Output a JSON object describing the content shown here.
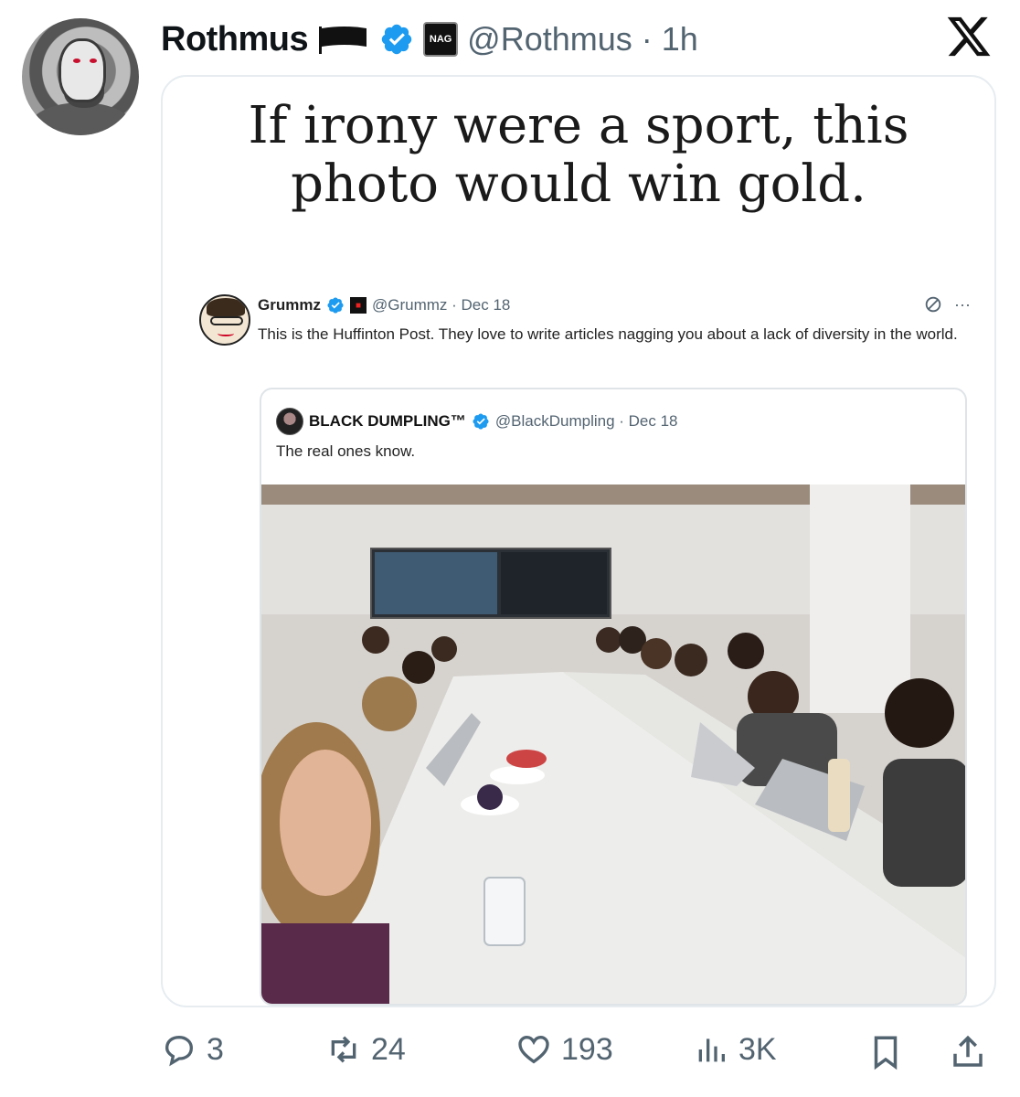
{
  "post": {
    "author_name": "Rothmus",
    "handle_time": "@Rothmus · 1h",
    "affiliate_badge": "NAG",
    "card_title": "If irony were a sport, this photo would win gold."
  },
  "quoted_tweet": {
    "name": "Grummz",
    "handle_date": "@Grummz · Dec 18",
    "text": "This is the Huffinton Post. They love to write articles nagging you about a lack of diversity in the world.",
    "more": "···"
  },
  "nested_quote": {
    "name": "BLACK DUMPLING™",
    "handle_date": "@BlackDumpling · Dec 18",
    "text": "The real ones know."
  },
  "actions": {
    "replies": "3",
    "reposts": "24",
    "likes": "193",
    "views": "3K"
  },
  "colors": {
    "verified": "#1d9bf0",
    "secondary_text": "#536471"
  },
  "icons": [
    "flag-icon",
    "verified-icon",
    "x-logo-icon",
    "reply-icon",
    "repost-icon",
    "like-icon",
    "views-icon",
    "bookmark-icon",
    "share-icon"
  ]
}
